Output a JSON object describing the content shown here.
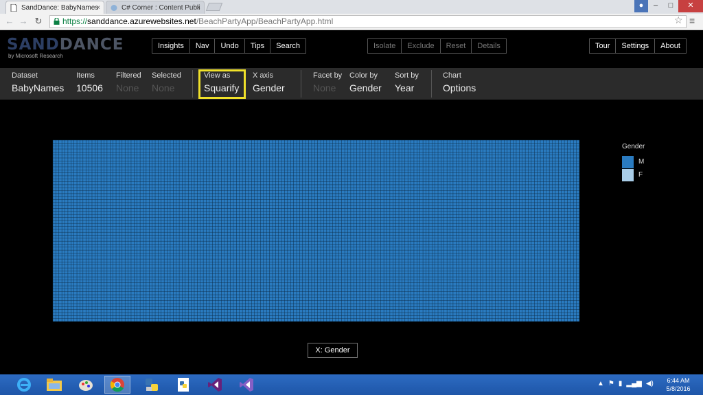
{
  "browser": {
    "tabs": [
      {
        "title": "SandDance: BabyNames",
        "active": true
      },
      {
        "title": "C# Corner : Content Publi",
        "active": false
      }
    ],
    "close_glyph": "×",
    "url": {
      "scheme": "https://",
      "host": "sanddance.azurewebsites.net",
      "path": "/BeachPartyApp/BeachPartyApp.html"
    },
    "icons": [
      "back-icon",
      "forward-icon",
      "reload-icon",
      "lock-icon",
      "star-icon",
      "menu-icon"
    ]
  },
  "app": {
    "logo": {
      "part1": "SAND",
      "part2": "DANCE",
      "subtitle": "by Microsoft Research"
    },
    "nav_buttons": [
      "Insights",
      "Nav",
      "Undo",
      "Tips",
      "Search"
    ],
    "selection_buttons": [
      "Isolate",
      "Exclude",
      "Reset",
      "Details"
    ],
    "right_buttons": [
      "Tour",
      "Settings",
      "About"
    ]
  },
  "toolbar": {
    "dataset": {
      "label": "Dataset",
      "value": "BabyNames"
    },
    "items": {
      "label": "Items",
      "value": "10506"
    },
    "filtered": {
      "label": "Filtered",
      "value": "None"
    },
    "selected": {
      "label": "Selected",
      "value": "None"
    },
    "view_as": {
      "label": "View as",
      "value": "Squarify"
    },
    "x_axis": {
      "label": "X axis",
      "value": "Gender"
    },
    "facet_by": {
      "label": "Facet by",
      "value": "None"
    },
    "color_by": {
      "label": "Color by",
      "value": "Gender"
    },
    "sort_by": {
      "label": "Sort by",
      "value": "Year"
    },
    "chart": {
      "label": "Chart",
      "value": "Options"
    }
  },
  "chart_data": {
    "type": "heatmap",
    "view": "Squarify",
    "item_count": 10506,
    "x_axis": "Gender",
    "color_by": "Gender",
    "legend": {
      "title": "Gender",
      "entries": [
        {
          "label": "M",
          "color": "#2a7bc0"
        },
        {
          "label": "F",
          "color": "#a9cde8"
        }
      ]
    },
    "legend_placement": "right",
    "axis_button_label": "X: Gender",
    "colors": {
      "cell": "#2a7bc0",
      "cell_border": "#0c2a44",
      "background": "#000000"
    }
  },
  "taskbar": {
    "apps": [
      "internet-explorer-icon",
      "file-explorer-icon",
      "paint-icon",
      "chrome-icon",
      "python-icon",
      "python-file-icon",
      "visual-studio-icon",
      "visual-studio-2-icon"
    ],
    "clock": {
      "time": "6:44 AM",
      "date": "5/8/2016"
    }
  }
}
